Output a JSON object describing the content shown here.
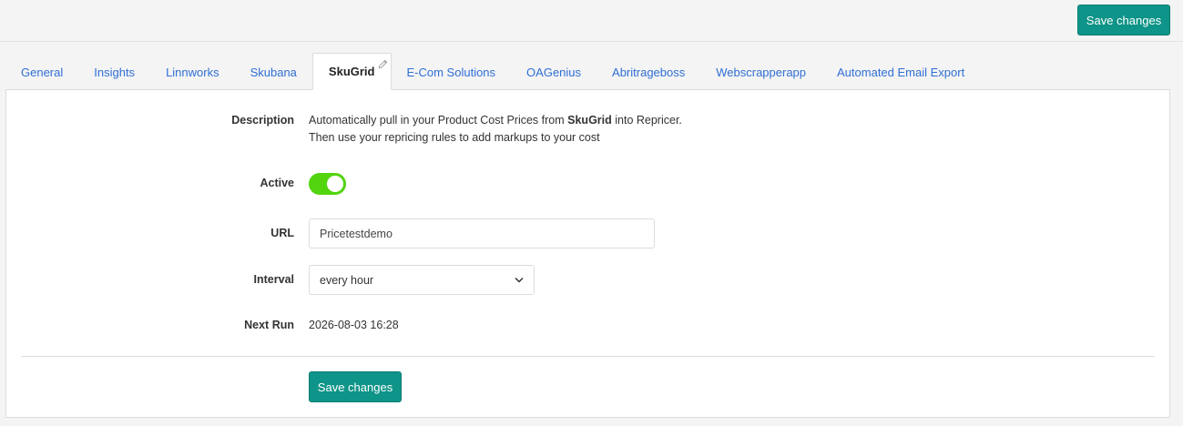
{
  "header": {
    "save_label": "Save changes"
  },
  "tabs": [
    {
      "label": "General"
    },
    {
      "label": "Insights"
    },
    {
      "label": "Linnworks"
    },
    {
      "label": "Skubana"
    },
    {
      "label": "SkuGrid"
    },
    {
      "label": "E-Com Solutions"
    },
    {
      "label": "OAGenius"
    },
    {
      "label": "Abritrageboss"
    },
    {
      "label": "Webscrapperapp"
    },
    {
      "label": "Automated Email Export"
    }
  ],
  "active_tab": "SkuGrid",
  "form": {
    "description": {
      "label": "Description",
      "line1_prefix": "Automatically pull in your Product Cost Prices from ",
      "line1_bold": "SkuGrid",
      "line1_suffix": " into Repricer.",
      "line2": "Then use your repricing rules to add markups to your cost"
    },
    "active": {
      "label": "Active",
      "on": true
    },
    "url": {
      "label": "URL",
      "value": "Pricetestdemo"
    },
    "interval": {
      "label": "Interval",
      "value": "every hour"
    },
    "next_run": {
      "label": "Next Run",
      "value": "2026-08-03 16:28"
    },
    "save_label": "Save changes"
  },
  "colors": {
    "accent": "#0e9488",
    "toggle_on": "#52d40e",
    "link": "#2f6fd6"
  },
  "icons": {
    "tab_edit": "pencil-icon",
    "select_arrow": "chevron-down-icon"
  }
}
